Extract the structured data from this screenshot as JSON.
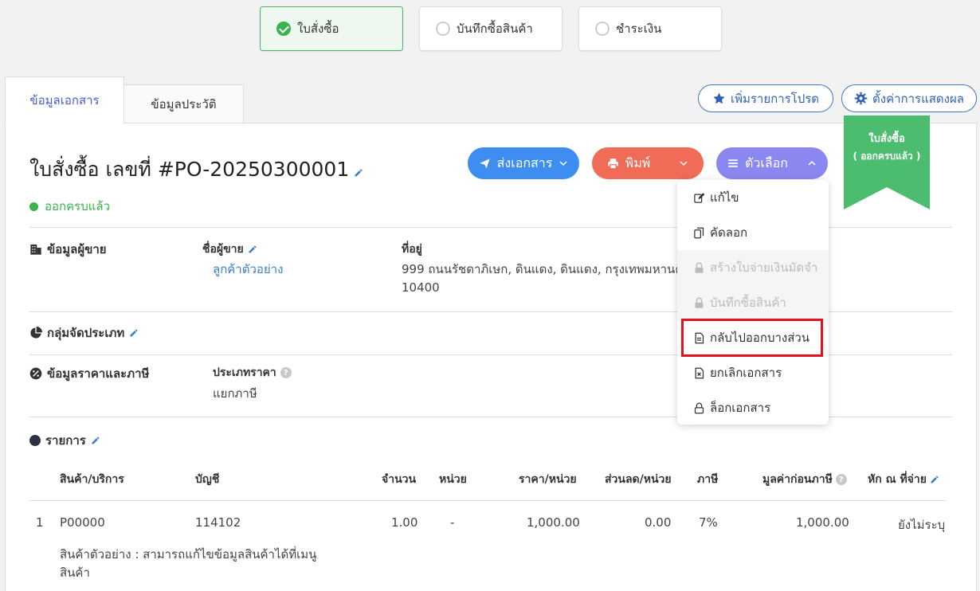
{
  "steps": [
    {
      "label": "ใบสั่งซื้อ",
      "active": true
    },
    {
      "label": "บันทึกซื้อสินค้า",
      "active": false
    },
    {
      "label": "ชำระเงิน",
      "active": false
    }
  ],
  "tabs": [
    {
      "label": "ข้อมูลเอกสาร",
      "active": true
    },
    {
      "label": "ข้อมูลประวัติ",
      "active": false
    }
  ],
  "header_buttons": {
    "favorite": "เพิ่มรายการโปรด",
    "display_settings": "ตั้งค่าการแสดงผล"
  },
  "document": {
    "title": "ใบสั่งซื้อ เลขที่ #PO-20250300001",
    "status": "ออกครบแล้ว"
  },
  "actions": {
    "send": "ส่งเอกสาร",
    "print": "พิมพ์",
    "options": "ตัวเลือก"
  },
  "ribbon": {
    "line1": "ใบสั่งซื้อ",
    "line2": "( ออกครบแล้ว )",
    "color": "#4cbd6f"
  },
  "menu": {
    "items": [
      {
        "label": "แก้ไข",
        "icon": "edit-icon",
        "disabled": false
      },
      {
        "label": "คัดลอก",
        "icon": "copy-icon",
        "disabled": false
      },
      {
        "label": "สร้างใบจ่ายเงินมัดจำ",
        "icon": "lock-icon",
        "disabled": true
      },
      {
        "label": "บันทึกซื้อสินค้า",
        "icon": "lock-icon",
        "disabled": true
      },
      {
        "label": "กลับไปออกบางส่วน",
        "icon": "document-icon",
        "disabled": false
      },
      {
        "label": "ยกเลิกเอกสาร",
        "icon": "cancel-document-icon",
        "disabled": false
      },
      {
        "label": "ล็อกเอกสาร",
        "icon": "padlock-icon",
        "disabled": false
      }
    ]
  },
  "seller": {
    "section_title": "ข้อมูลผู้ขาย",
    "name_label": "ชื่อผู้ขาย",
    "name_value": "ลูกค้าตัวอย่าง",
    "address_label": "ที่อยู่",
    "address_line1": "999 ถนนรัชดาภิเษก, ดินแดง, ดินแดง, กรุงเทพมหานคร,",
    "address_line2": "10400"
  },
  "category": {
    "section_title": "กลุ่มจัดประเภท"
  },
  "pricing": {
    "section_title": "ข้อมูลราคาและภาษี",
    "price_type_label": "ประเภทราคา",
    "price_type_value": "แยกภาษี"
  },
  "items_section": {
    "title": "รายการ",
    "headers": {
      "product": "สินค้า/บริการ",
      "account": "บัญชี",
      "qty": "จำนวน",
      "unit": "หน่วย",
      "price": "ราคา/หน่วย",
      "discount": "ส่วนลด/หน่วย",
      "tax": "ภาษี",
      "pretax": "มูลค่าก่อนภาษี",
      "wht": "หัก ณ ที่จ่าย"
    },
    "rows": [
      {
        "no": "1",
        "product": "P00000",
        "account": "114102",
        "qty": "1.00",
        "unit": "-",
        "price": "1,000.00",
        "discount": "0.00",
        "tax": "7%",
        "pretax": "1,000.00",
        "wht": "ยังไม่ระบุ",
        "desc_line1": "สินค้าตัวอย่าง : สามารถแก้ไขข้อมูลสินค้าได้ที่เมนู",
        "desc_line2": "สินค้า"
      }
    ]
  }
}
